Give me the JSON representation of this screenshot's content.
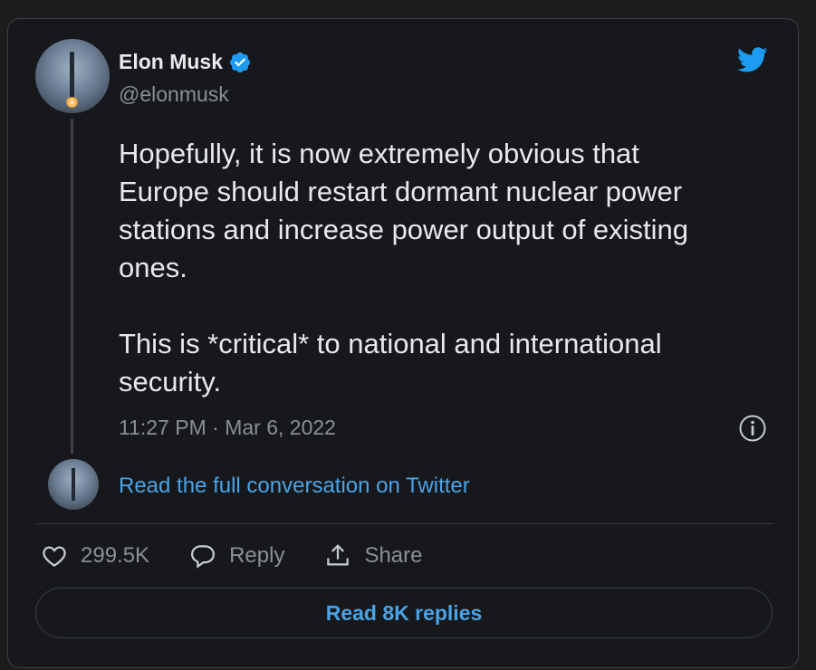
{
  "author": {
    "name": "Elon Musk",
    "handle": "@elonmusk",
    "avatar_icon": "rocket-avatar",
    "verified_icon": "verified-badge-icon"
  },
  "tweet": {
    "text": "Hopefully, it is now extremely obvious that\nEurope should restart dormant nuclear power\nstations and increase power output of existing\nones.\n\nThis is *critical* to national and international\nsecurity.",
    "time": "11:27 PM",
    "separator": "·",
    "date": "Mar 6, 2022"
  },
  "conversation": {
    "link_text": "Read the full conversation on Twitter"
  },
  "actions": {
    "likes_count": "299.5K",
    "reply_label": "Reply",
    "share_label": "Share"
  },
  "footer": {
    "read_replies_label": "Read 8K replies"
  },
  "colors": {
    "accent": "#4ba3e6",
    "background": "#16181b",
    "text": "#e7e9ea",
    "muted": "#8b9096"
  }
}
